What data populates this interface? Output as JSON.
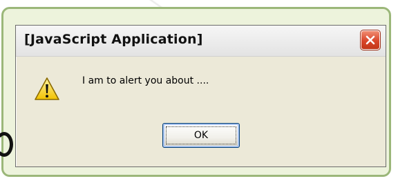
{
  "dialog": {
    "title": "[JavaScript Application]",
    "message": "I am to alert you about ....",
    "ok_label": "OK"
  },
  "icons": {
    "warning": "warning-icon",
    "close": "close-icon"
  },
  "colors": {
    "frame_background": "#edf3dc",
    "frame_border": "#9bb779",
    "dialog_background": "#ece9d8",
    "close_button": "#d9462a",
    "warning_yellow": "#f5d11a"
  }
}
